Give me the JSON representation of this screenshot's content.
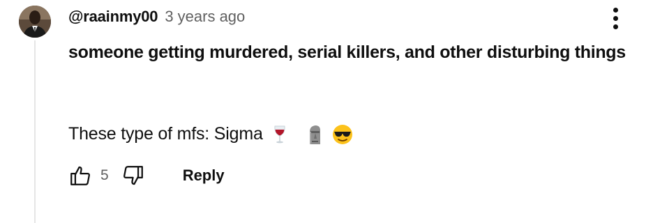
{
  "comment": {
    "author": "@raainmy00",
    "timestamp": "3 years ago",
    "text_line1": "someone getting murdered, serial killers, and other disturbing things",
    "text_line2": "These type of mfs: Sigma",
    "emojis": [
      "wine-glass-icon",
      "moai-icon",
      "sunglasses-face-icon"
    ],
    "like_count": "5",
    "reply_label": "Reply"
  },
  "colors": {
    "text_primary": "#0f0f0f",
    "text_secondary": "#606060",
    "thread_line": "#e5e5e5"
  }
}
